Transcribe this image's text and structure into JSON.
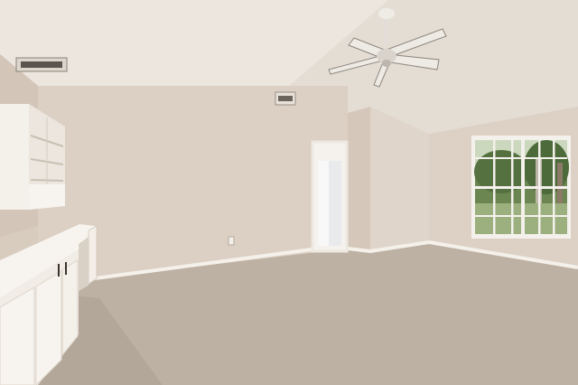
{
  "scene": {
    "type": "photo",
    "room": "empty-bedroom-interior"
  },
  "colors": {
    "ceiling": "#ece6df",
    "ceiling_shade": "#ddd5cc",
    "wall": "#dccfc3",
    "wall_shade": "#cfc1b3",
    "wall_light": "#e6dcd1",
    "carpet": "#bdb1a3",
    "carpet_dark": "#a89c8f",
    "baseboard": "#f4f0ea",
    "cabinet": "#f6f3ee",
    "window_trees": "#5f7a44",
    "window_sky": "#d9e4cf",
    "fan": "#efece6"
  }
}
